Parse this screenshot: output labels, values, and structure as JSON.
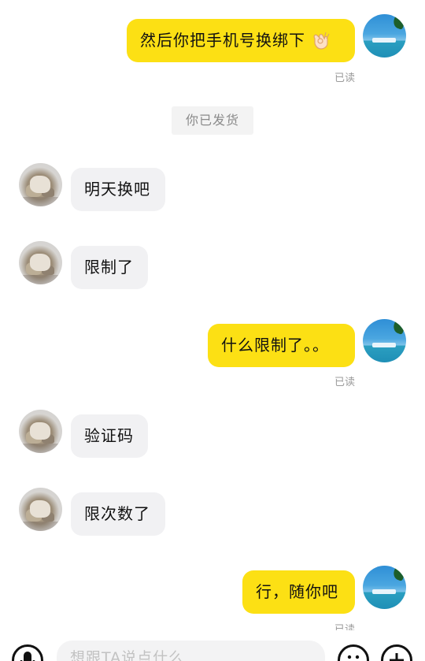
{
  "messages": [
    {
      "side": "right",
      "text": "然后你把手机号换绑下",
      "emoji": "ok-hand",
      "read": "已读"
    },
    {
      "side": "center",
      "text": "你已发货"
    },
    {
      "side": "left",
      "text": "明天换吧"
    },
    {
      "side": "left",
      "text": "限制了"
    },
    {
      "side": "right",
      "text": "什么限制了。。",
      "read": "已读"
    },
    {
      "side": "left",
      "text": "验证码"
    },
    {
      "side": "left",
      "text": "限次数了"
    },
    {
      "side": "right",
      "text": "行，随你吧",
      "read": "已读"
    }
  ],
  "input": {
    "placeholder": "想跟TA说点什么"
  },
  "icons": {
    "voice": "microphone-icon",
    "emoji": "smile-icon",
    "more": "plus-icon"
  },
  "colors": {
    "self_bubble": "#fce014",
    "other_bubble": "#f1f1f3",
    "read_text": "#9b9b9b"
  }
}
